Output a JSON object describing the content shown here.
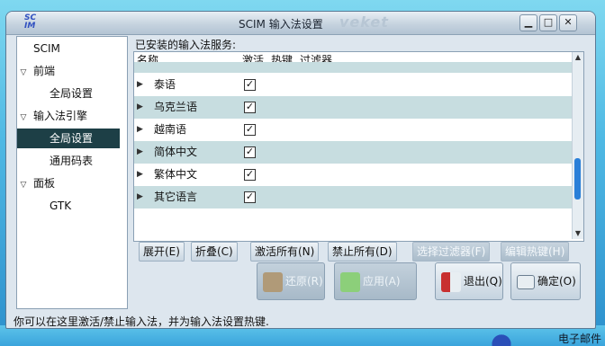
{
  "window": {
    "title": "SCIM 输入法设置",
    "brand": "veket",
    "app_icon_text": "SC\nIM",
    "controls": [
      "▁",
      "□",
      "✕"
    ]
  },
  "sidebar": {
    "items": [
      {
        "label": "SCIM",
        "indent": 0,
        "expander": ""
      },
      {
        "label": "前端",
        "indent": 0,
        "expander": "▽"
      },
      {
        "label": "全局设置",
        "indent": 2,
        "expander": ""
      },
      {
        "label": "输入法引擎",
        "indent": 0,
        "expander": "▽"
      },
      {
        "label": "全局设置",
        "indent": 2,
        "expander": "",
        "selected": true
      },
      {
        "label": "通用码表",
        "indent": 2,
        "expander": ""
      },
      {
        "label": "面板",
        "indent": 0,
        "expander": "▽"
      },
      {
        "label": "GTK",
        "indent": 2,
        "expander": ""
      }
    ]
  },
  "main": {
    "section_label": "已安装的输入法服务:",
    "columns": {
      "name": "名称",
      "activate": "激活",
      "hotkey": "热键",
      "filter": "过滤器"
    },
    "rows": [
      {
        "name": "泰语",
        "checked": true
      },
      {
        "name": "乌克兰语",
        "checked": true
      },
      {
        "name": "越南语",
        "checked": true
      },
      {
        "name": "简体中文",
        "checked": true
      },
      {
        "name": "繁体中文",
        "checked": true
      },
      {
        "name": "其它语言",
        "checked": true
      }
    ],
    "scroll_position": 0.62
  },
  "buttons": {
    "expand": "展开(E)",
    "collapse": "折叠(C)",
    "activate_all": "激活所有(N)",
    "deactivate_all": "禁止所有(D)",
    "select_filter": "选择过滤器(F)",
    "edit_hotkey": "编辑热键(H)",
    "restore": "还原(R)",
    "apply": "应用(A)",
    "exit": "退出(Q)",
    "ok": "确定(O)"
  },
  "status": "你可以在这里激活/禁止输入法，并为输入法设置热键.",
  "desktop": {
    "taskbar_text": "电子邮件"
  },
  "colors": {
    "selected_bg": "#1d3f46",
    "row_alt": "#c7dde0",
    "scroll_thumb": "#2a7fd8"
  }
}
